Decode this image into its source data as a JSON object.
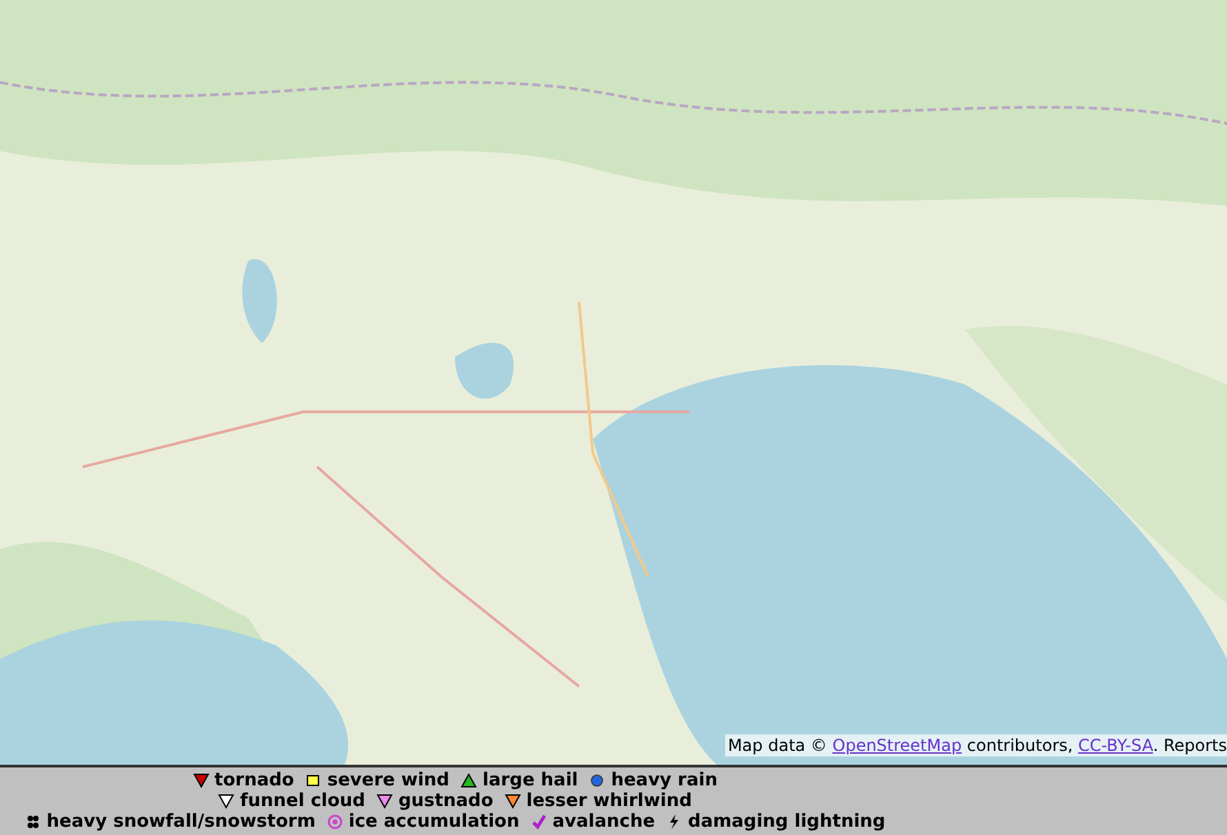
{
  "map": {
    "kind": "picture",
    "attribution": {
      "prefix": "Map data © ",
      "links": [
        "OpenStreetMap",
        "CC-BY-SA"
      ],
      "middle": " contributors, ",
      "suffix": ". Reports"
    }
  },
  "legend": {
    "rows": [
      [
        {
          "label": "tornado",
          "kind": "triangle-down",
          "color": "#cc0000"
        },
        {
          "label": "severe wind",
          "kind": "square",
          "color": "#ffff44"
        },
        {
          "label": "large hail",
          "kind": "triangle-up",
          "color": "#22bb22"
        },
        {
          "label": "heavy rain",
          "kind": "circle",
          "color": "#2266dd"
        }
      ],
      [
        {
          "label": "funnel cloud",
          "kind": "triangle-down",
          "color": "#ffffff"
        },
        {
          "label": "gustnado",
          "kind": "triangle-down",
          "color": "#ee88ee"
        },
        {
          "label": "lesser whirlwind",
          "kind": "triangle-down",
          "color": "#ff8833"
        }
      ],
      [
        {
          "label": "heavy snowfall/snowstorm",
          "kind": "snow",
          "color": "#000000"
        },
        {
          "label": "ice accumulation",
          "kind": "ring",
          "color": "#cc44cc"
        },
        {
          "label": "avalanche",
          "kind": "check",
          "color": "#aa22cc"
        },
        {
          "label": "damaging lightning",
          "kind": "bolt",
          "color": "#000000"
        }
      ]
    ]
  }
}
